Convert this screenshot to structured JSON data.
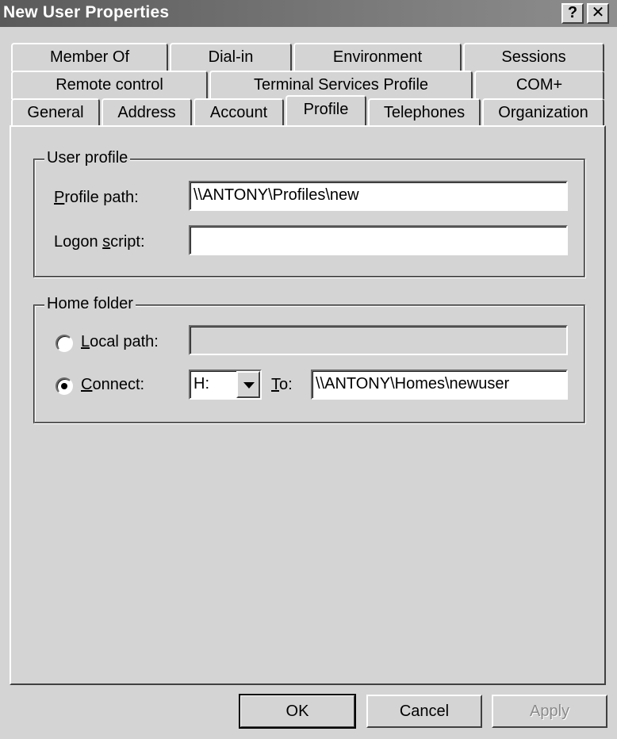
{
  "window": {
    "title": "New User Properties",
    "help_label": "?",
    "close_label": "✕"
  },
  "tabs": {
    "row1": [
      "Member Of",
      "Dial-in",
      "Environment",
      "Sessions"
    ],
    "row2": [
      "Remote control",
      "Terminal Services Profile",
      "COM+"
    ],
    "row3": [
      "General",
      "Address",
      "Account",
      "Profile",
      "Telephones",
      "Organization"
    ],
    "active": "Profile"
  },
  "user_profile": {
    "legend": "User profile",
    "profile_path_label_pre": "",
    "profile_path_label_key": "P",
    "profile_path_label_post": "rofile path:",
    "profile_path_value": "\\\\ANTONY\\Profiles\\new",
    "logon_script_label_pre": "Logon ",
    "logon_script_label_key": "s",
    "logon_script_label_post": "cript:",
    "logon_script_value": ""
  },
  "home_folder": {
    "legend": "Home folder",
    "local_path_label_pre": "",
    "local_path_label_key": "L",
    "local_path_label_post": "ocal path:",
    "local_path_value": "",
    "connect_label_pre": "",
    "connect_label_key": "C",
    "connect_label_post": "onnect:",
    "drive_value": "H:",
    "to_label_key": "T",
    "to_label_post": "o:",
    "to_value": "\\\\ANTONY\\Homes\\newuser",
    "selected": "connect"
  },
  "buttons": {
    "ok": "OK",
    "cancel": "Cancel",
    "apply": "Apply"
  }
}
